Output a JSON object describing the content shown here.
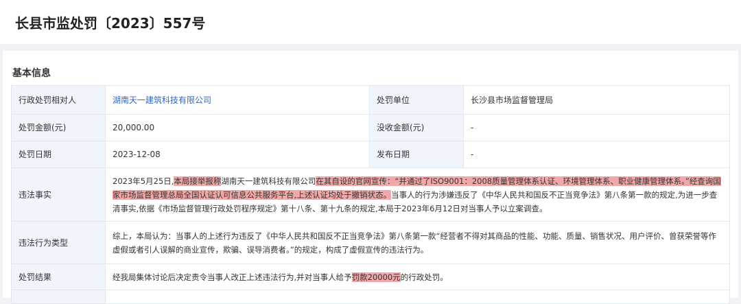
{
  "header": {
    "title": "长县市监处罚〔2023〕557号"
  },
  "section": {
    "title": "基本信息"
  },
  "rows": {
    "party": {
      "label": "行政处罚相对人",
      "value": "湖南天一建筑科技有限公司"
    },
    "unit": {
      "label": "处罚单位",
      "value": "长沙县市场监督管理局"
    },
    "fine": {
      "label": "处罚金额(元)",
      "value": "20,000.00"
    },
    "confiscation": {
      "label": "没收金额(元)",
      "value": "-"
    },
    "date": {
      "label": "处罚日期",
      "value": "2023-12-08"
    },
    "publish": {
      "label": "发布日期",
      "value": "-"
    },
    "facts": {
      "label": "违法事实",
      "p1": "2023年5月25日,",
      "h1": "本局接举报称",
      "p2": "湖南天一建筑科技有限公司",
      "h2": "在其自设的官网宣传：“并通过了ISO9001：2008质量管理体系认证、环境管理体系、职业健康管理体系。”",
      "h3": "经查询国家市场监督管理总局全国认证认可信息公共服务平台,上述认证均处于撤销状态。",
      "p3": "当事人的行为涉嫌违反了《中华人民共和国反不正当竞争法》第八条第一款的规定,为进一步查清事实,依据《市场监督管理行政处罚程序规定》第十八条、第十九条的规定,本局于2023年6月12日对当事人予以立案调查。"
    },
    "violation_type": {
      "label": "违法行为类型",
      "value": "综上，本局认为：当事人的上述行为违反了《中华人民共和国反不正当竞争法》第八条第一款“经营者不得对其商品的性能、功能、质量、销售状况、用户评价、曾获荣誉等作虚假或者引人误解的商业宣传，欺骗、误导消费者。”的规定，构成了虚假宣传的违法行为。"
    },
    "result": {
      "label": "处罚结果",
      "p1": "经我局集体讨论后决定责令当事人改正上述违法行为,并对当事人给予",
      "h1": "罚款20000元",
      "p2": "的行政处罚。"
    }
  },
  "colors": {
    "accent": "#3068c6",
    "label_bg": "#f0f5fc",
    "highlight": "#f2a8a8"
  }
}
